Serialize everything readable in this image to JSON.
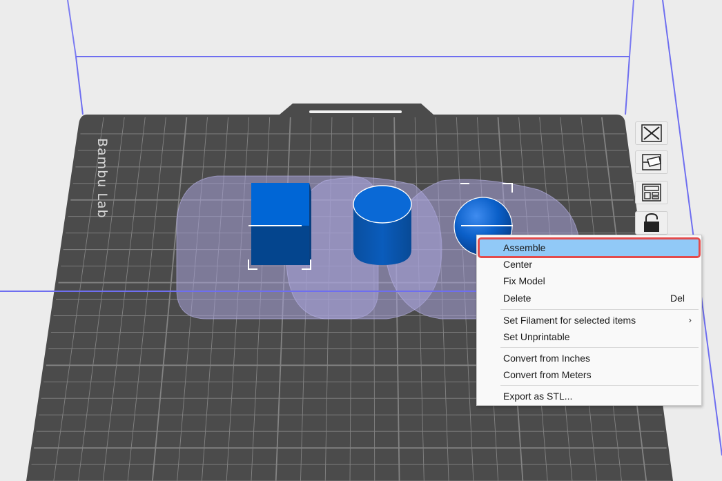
{
  "scene": {
    "plate_brand": "Bambu Lab",
    "objects": [
      {
        "name": "cube"
      },
      {
        "name": "cylinder"
      },
      {
        "name": "sphere"
      }
    ]
  },
  "side_tools": [
    {
      "name": "clear-plate",
      "icon": "close-x-icon"
    },
    {
      "name": "auto-orient",
      "icon": "orient-icon"
    },
    {
      "name": "arrange",
      "icon": "arrange-layout-icon"
    },
    {
      "name": "lock",
      "icon": "lock-icon"
    }
  ],
  "context_menu": {
    "assemble": "Assemble",
    "center": "Center",
    "fix_model": "Fix Model",
    "delete": "Delete",
    "delete_shortcut": "Del",
    "set_filament": "Set Filament for selected items",
    "set_filament_chevron": "›",
    "set_unprintable": "Set Unprintable",
    "convert_inches": "Convert from Inches",
    "convert_meters": "Convert from Meters",
    "export_stl": "Export as STL..."
  },
  "colors": {
    "plate": "#4b4b4b",
    "grid_line": "#8a8a8a",
    "build_volume": "#6e6ef0",
    "object_blue": "#0066cc",
    "highlight": "#91c9f7",
    "highlight_border": "#e34b4b"
  }
}
